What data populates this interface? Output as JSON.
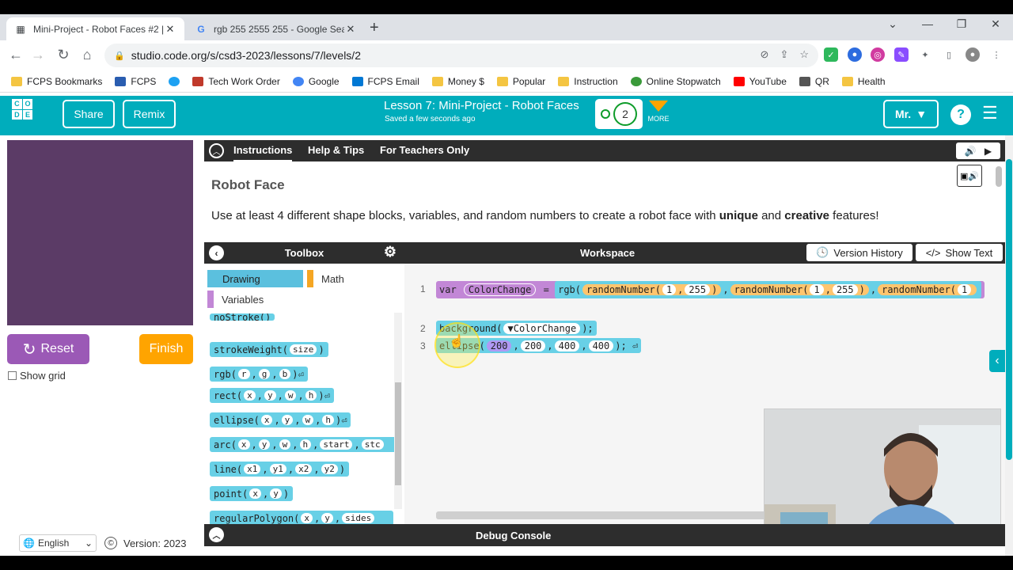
{
  "browser": {
    "tabs": [
      {
        "title": "Mini-Project - Robot Faces #2 | L",
        "icon": "code-org-icon",
        "active": true
      },
      {
        "title": "rgb 255 2555 255 - Google Searc",
        "icon": "google-icon",
        "active": false
      }
    ],
    "url": "studio.code.org/s/csd3-2023/lessons/7/levels/2",
    "bookmarks": [
      {
        "label": "FCPS Bookmarks",
        "icon": "folder-icon",
        "color": "#f4c542"
      },
      {
        "label": "FCPS",
        "icon": "fcps-icon",
        "color": "#2a5db0"
      },
      {
        "label": "",
        "icon": "twitter-icon",
        "color": "#1da1f2"
      },
      {
        "label": "Tech Work Order",
        "icon": "tech-icon",
        "color": "#c0392b"
      },
      {
        "label": "Google",
        "icon": "google-icon",
        "color": "#4285f4"
      },
      {
        "label": "FCPS Email",
        "icon": "outlook-icon",
        "color": "#0078d4"
      },
      {
        "label": "Money $",
        "icon": "folder-icon",
        "color": "#f4c542"
      },
      {
        "label": "Popular",
        "icon": "folder-icon",
        "color": "#f4c542"
      },
      {
        "label": "Instruction",
        "icon": "folder-icon",
        "color": "#f4c542"
      },
      {
        "label": "Online Stopwatch",
        "icon": "stopwatch-icon",
        "color": "#3a9a3a"
      },
      {
        "label": "YouTube",
        "icon": "youtube-icon",
        "color": "#ff0000"
      },
      {
        "label": "QR",
        "icon": "qr-icon",
        "color": "#555555"
      },
      {
        "label": "Health",
        "icon": "folder-icon",
        "color": "#f4c542"
      }
    ]
  },
  "header": {
    "logo_letters": [
      "C",
      "O",
      "",
      "D",
      "E",
      ""
    ],
    "share_label": "Share",
    "remix_label": "Remix",
    "lesson_title": "Lesson 7: Mini-Project - Robot Faces",
    "saved_status": "Saved a few seconds ago",
    "progress_level": "2",
    "more_label": "MORE",
    "user_label": "Mr.",
    "help_label": "?"
  },
  "left": {
    "reset_label": "Reset",
    "finish_label": "Finish",
    "show_grid_label": "Show grid",
    "language": "English",
    "version": "Version: 2023",
    "canvas_color": "#5b3b66"
  },
  "instructions": {
    "tabs": [
      "Instructions",
      "Help & Tips",
      "For Teachers Only"
    ],
    "title": "Robot Face",
    "text_parts": [
      "Use at least 4 different shape blocks, variables, and random numbers to create a robot face with ",
      "unique",
      " and ",
      "creative",
      " features!"
    ]
  },
  "toolbox": {
    "title": "Toolbox",
    "categories": [
      {
        "label": "Drawing",
        "color": "#5bc0de"
      },
      {
        "label": "Math",
        "color": "#f5a623"
      },
      {
        "label": "Variables",
        "color": "#c287d6"
      }
    ],
    "blocks": [
      {
        "name": "noStroke",
        "args": []
      },
      {
        "name": "strokeWeight",
        "args": [
          "size"
        ]
      },
      {
        "name": "rgb",
        "args": [
          "r",
          "g",
          "b"
        ]
      },
      {
        "name": "rect",
        "args": [
          "x",
          "y",
          "w",
          "h"
        ]
      },
      {
        "name": "ellipse",
        "args": [
          "x",
          "y",
          "w",
          "h"
        ]
      },
      {
        "name": "arc",
        "args": [
          "x",
          "y",
          "w",
          "h",
          "start",
          "stc"
        ]
      },
      {
        "name": "line",
        "args": [
          "x1",
          "y1",
          "x2",
          "y2"
        ]
      },
      {
        "name": "point",
        "args": [
          "x",
          "y"
        ]
      },
      {
        "name": "regularPolygon",
        "args": [
          "x",
          "y",
          "sides"
        ]
      }
    ]
  },
  "workspace": {
    "title": "Workspace",
    "version_history_label": "Version History",
    "show_text_label": "Show Text",
    "lines": {
      "l1": {
        "num": "1",
        "kw": "var",
        "name": "ColorChange",
        "eq": "=",
        "fn": "rgb(",
        "r1": "randomNumber(",
        "a1": "1",
        "b1": "255",
        "r2": "randomNumber(",
        "a2": "1",
        "b2": "255",
        "r3": "randomNumber(",
        "a3": "1"
      },
      "l2": {
        "num": "2",
        "fn": "background(",
        "arg": "ColorChange",
        "end": ");"
      },
      "l3": {
        "num": "3",
        "fn": "ellipse(",
        "a": "200",
        "b": "200",
        "c": "400",
        "d": "400",
        "end": ");"
      }
    }
  },
  "debug": {
    "title": "Debug Console"
  }
}
